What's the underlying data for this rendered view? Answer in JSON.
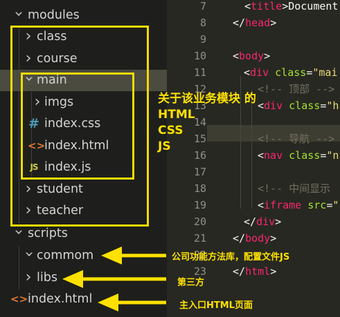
{
  "explorer": {
    "tree": [
      {
        "id": "modules",
        "label": "modules",
        "type": "folder",
        "open": true
      },
      {
        "id": "class",
        "label": "class",
        "type": "folder",
        "open": false
      },
      {
        "id": "course",
        "label": "course",
        "type": "folder",
        "open": false
      },
      {
        "id": "main",
        "label": "main",
        "type": "folder",
        "open": true,
        "selected": true
      },
      {
        "id": "imgs",
        "label": "imgs",
        "type": "folder",
        "open": false
      },
      {
        "id": "index-css",
        "label": "index.css",
        "type": "file",
        "icon": "css-file-icon"
      },
      {
        "id": "index-html-main",
        "label": "index.html",
        "type": "file",
        "icon": "html-file-icon"
      },
      {
        "id": "index-js",
        "label": "index.js",
        "type": "file",
        "icon": "js-file-icon"
      },
      {
        "id": "student",
        "label": "student",
        "type": "folder",
        "open": false
      },
      {
        "id": "teacher",
        "label": "teacher",
        "type": "folder",
        "open": false
      },
      {
        "id": "scripts",
        "label": "scripts",
        "type": "folder",
        "open": true
      },
      {
        "id": "commom",
        "label": "commom",
        "type": "folder",
        "open": true
      },
      {
        "id": "libs",
        "label": "libs",
        "type": "folder",
        "open": false
      },
      {
        "id": "index-html-root",
        "label": "index.html",
        "type": "file",
        "icon": "html-file-icon"
      }
    ],
    "icon_glyphs": {
      "css": "#",
      "html": "<>",
      "js": "JS"
    }
  },
  "editor": {
    "line_numbers": [
      "7",
      "8",
      "9",
      "10",
      "11",
      "12",
      "13",
      "14",
      "15",
      "16",
      "17",
      "18",
      "19",
      "20",
      "21",
      "22",
      "23"
    ],
    "code": [
      {
        "ln": "7",
        "parts": [
          [
            "pun",
            "<"
          ],
          [
            "tag",
            "title"
          ],
          [
            "pun",
            ">Document"
          ]
        ]
      },
      {
        "ln": "8",
        "parts": [
          [
            "pun",
            "</"
          ],
          [
            "tag",
            "head"
          ],
          [
            "pun",
            ">"
          ]
        ]
      },
      {
        "ln": "9",
        "parts": []
      },
      {
        "ln": "10",
        "parts": [
          [
            "pun",
            "<"
          ],
          [
            "tag",
            "body"
          ],
          [
            "pun",
            ">"
          ]
        ]
      },
      {
        "ln": "11",
        "parts": [
          [
            "pun",
            "<"
          ],
          [
            "tag",
            "div"
          ],
          [
            "pun",
            " "
          ],
          [
            "attr",
            "class"
          ],
          [
            "pun",
            "="
          ],
          [
            "str",
            "\"mai"
          ]
        ]
      },
      {
        "ln": "12",
        "parts": [
          [
            "com",
            "<!-- 顶部 -->"
          ]
        ]
      },
      {
        "ln": "13",
        "parts": [
          [
            "pun",
            "<"
          ],
          [
            "tag",
            "div"
          ],
          [
            "pun",
            " "
          ],
          [
            "attr",
            "class"
          ],
          [
            "pun",
            "="
          ],
          [
            "str",
            "\"h"
          ]
        ]
      },
      {
        "ln": "14",
        "parts": []
      },
      {
        "ln": "15",
        "parts": [
          [
            "com",
            "<!-- 导航 -->"
          ]
        ]
      },
      {
        "ln": "16",
        "parts": [
          [
            "pun",
            "<"
          ],
          [
            "tag",
            "nav"
          ],
          [
            "pun",
            " "
          ],
          [
            "attr",
            "class"
          ],
          [
            "pun",
            "="
          ],
          [
            "str",
            "\"n"
          ]
        ]
      },
      {
        "ln": "17",
        "parts": []
      },
      {
        "ln": "18",
        "parts": [
          [
            "com",
            "<!-- 中间显示"
          ]
        ]
      },
      {
        "ln": "19",
        "parts": [
          [
            "pun",
            "<"
          ],
          [
            "tag",
            "iframe"
          ],
          [
            "pun",
            " "
          ],
          [
            "attr",
            "src"
          ],
          [
            "pun",
            "="
          ],
          [
            "str",
            "\""
          ]
        ]
      },
      {
        "ln": "20",
        "parts": [
          [
            "pun",
            "</"
          ],
          [
            "tag",
            "div"
          ],
          [
            "pun",
            ">"
          ]
        ]
      },
      {
        "ln": "21",
        "parts": [
          [
            "pun",
            "</"
          ],
          [
            "tag",
            "body"
          ],
          [
            "pun",
            ">"
          ]
        ]
      },
      {
        "ln": "22",
        "parts": []
      },
      {
        "ln": "23",
        "parts": [
          [
            "pun",
            "</"
          ],
          [
            "tag",
            "html"
          ],
          [
            "pun",
            ">"
          ]
        ]
      }
    ]
  },
  "annotations": {
    "main_note": [
      "关于该业务模块 的",
      "HTML",
      "CSS",
      "JS"
    ],
    "commom_note": "公司功能方法库，配置文件JS",
    "libs_note": "第三方",
    "index_note": "主入口HTML页面"
  },
  "colors": {
    "annotation": "#ffe100",
    "box": "#f5dc00",
    "sidebar_bg": "#1e1f1c",
    "editor_bg": "#272822",
    "selected_row": "#4b4b40",
    "tag": "#f92672",
    "attr": "#a6e22e",
    "string": "#e6db74",
    "comment": "#75715e"
  }
}
